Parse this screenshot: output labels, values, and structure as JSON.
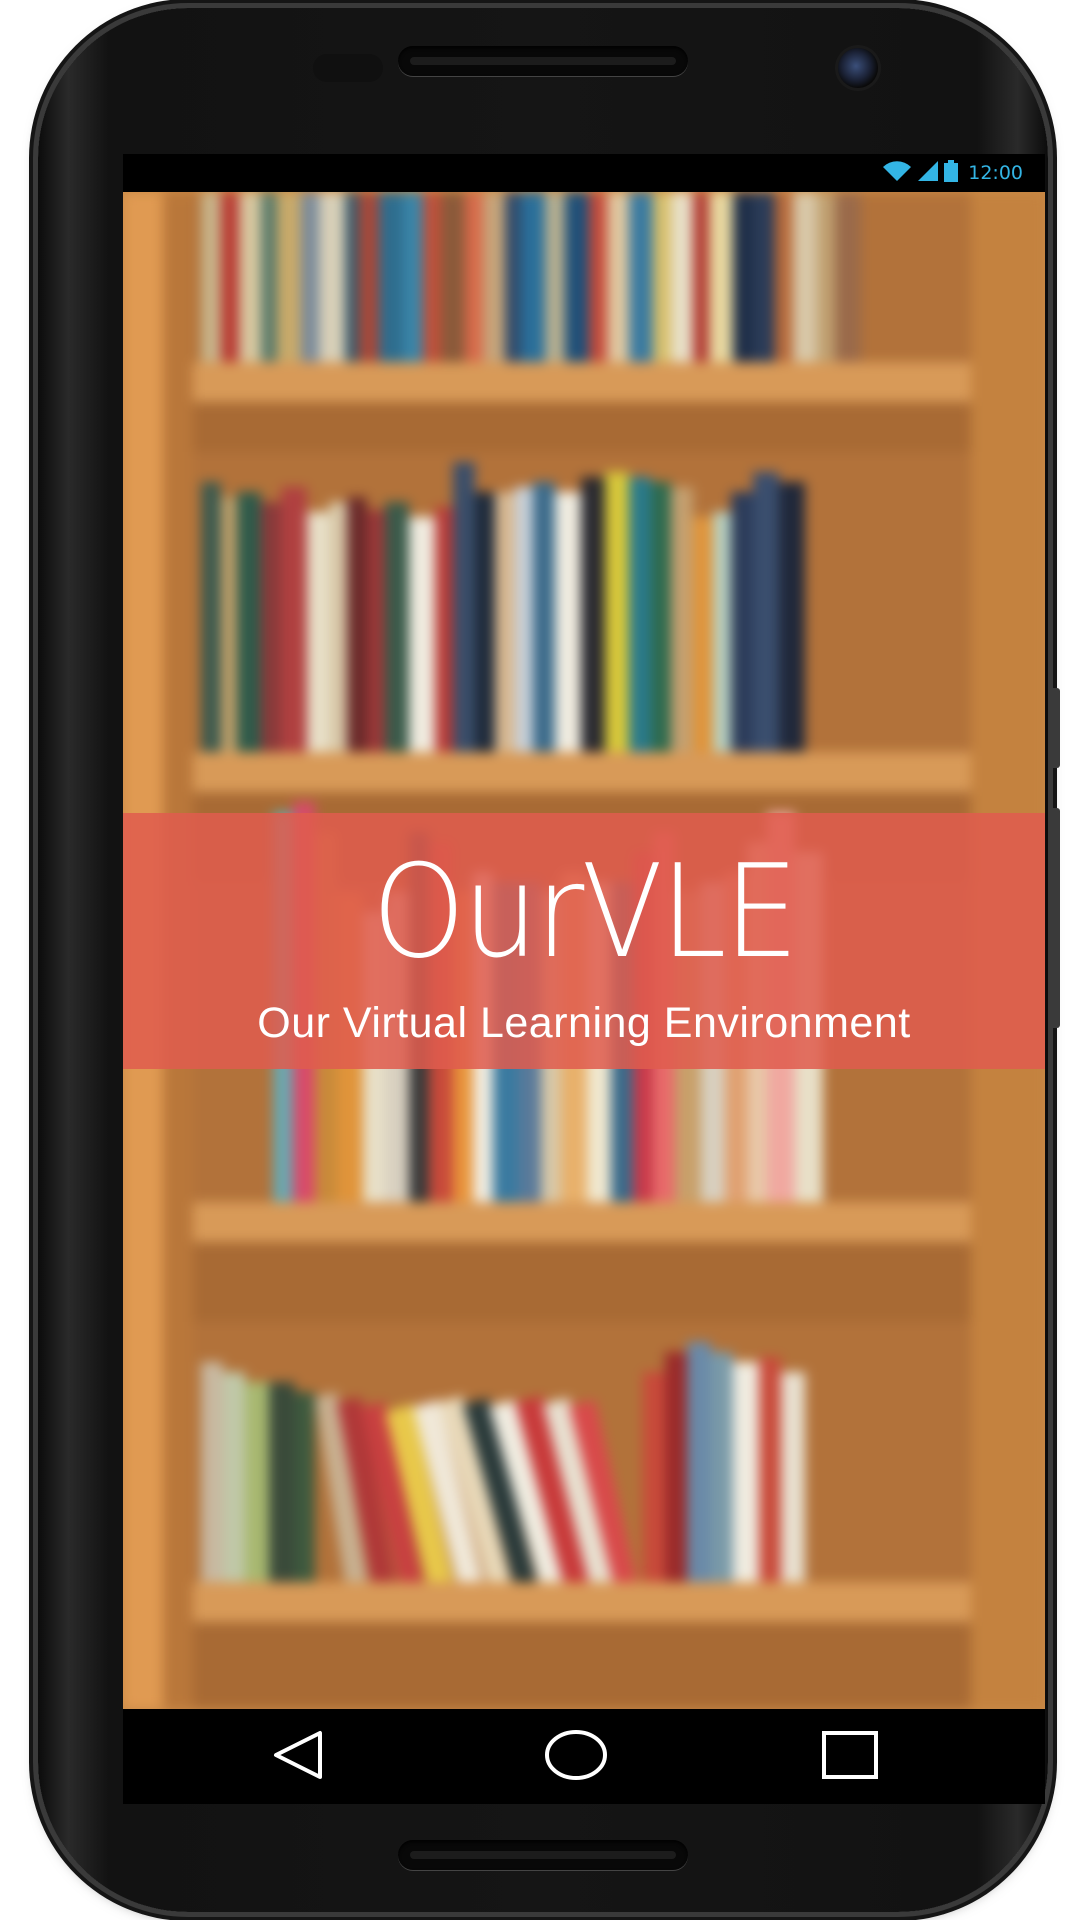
{
  "status_bar": {
    "time": "12:00",
    "icons": [
      "wifi-icon",
      "signal-icon",
      "battery-icon"
    ],
    "accent_color": "#33b5e5"
  },
  "splash": {
    "title": "OurVLE",
    "subtitle": "Our Virtual Learning Environment",
    "banner_color": "#e05c4e",
    "background": "bookshelf-image"
  },
  "nav_bar": {
    "buttons": [
      {
        "name": "back",
        "icon": "back-triangle-icon"
      },
      {
        "name": "home",
        "icon": "home-circle-icon"
      },
      {
        "name": "recents",
        "icon": "recents-square-icon"
      }
    ]
  }
}
